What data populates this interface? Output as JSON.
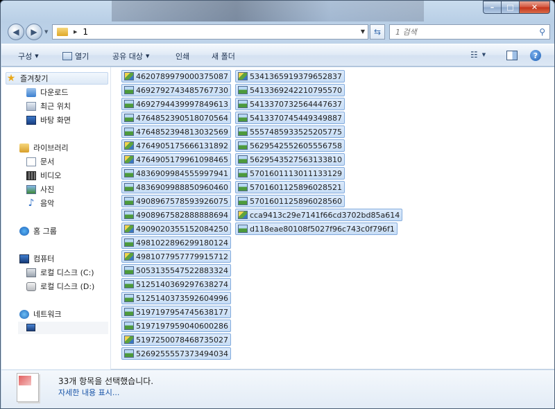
{
  "window": {
    "caption_buttons": {
      "minimize": "–",
      "maximize": "□",
      "close": "✕"
    }
  },
  "address_bar": {
    "path": "1",
    "search_placeholder": "1 검색"
  },
  "toolbar": {
    "organize": "구성",
    "open": "열기",
    "share_with": "공유 대상",
    "print": "인쇄",
    "new_folder": "새 폴더"
  },
  "nav": {
    "favorites": "즐겨찾기",
    "downloads": "다운로드",
    "recent_places": "최근 위치",
    "desktop": "바탕 화면",
    "libraries": "라이브러리",
    "documents": "문서",
    "videos": "비디오",
    "pictures": "사진",
    "music": "음악",
    "homegroup": "홈 그룹",
    "computer": "컴퓨터",
    "local_disk_c": "로컬 디스크 (C:)",
    "local_disk_d": "로컬 디스크 (D:)",
    "network": "네트워크"
  },
  "files": {
    "col1": [
      {
        "name": "4620789979000375087",
        "thumb": "b"
      },
      {
        "name": "4692792743485767730",
        "thumb": "a"
      },
      {
        "name": "4692794439997849613",
        "thumb": "a"
      },
      {
        "name": "4764852390518070564",
        "thumb": "a"
      },
      {
        "name": "4764852394813032569",
        "thumb": "a"
      },
      {
        "name": "4764905175666131892",
        "thumb": "b"
      },
      {
        "name": "4764905179961098465",
        "thumb": "b"
      },
      {
        "name": "4836909984555997941",
        "thumb": "a"
      },
      {
        "name": "4836909988850960460",
        "thumb": "a"
      },
      {
        "name": "4908967578593926075",
        "thumb": "a"
      },
      {
        "name": "4908967582888888694",
        "thumb": "a"
      },
      {
        "name": "4909020355152084250",
        "thumb": "b"
      },
      {
        "name": "4981022896299180124",
        "thumb": "a"
      },
      {
        "name": "4981077957779915712",
        "thumb": "b"
      },
      {
        "name": "5053135547522883324",
        "thumb": "a"
      },
      {
        "name": "5125140369297638274",
        "thumb": "a"
      },
      {
        "name": "5125140373592604996",
        "thumb": "a"
      },
      {
        "name": "5197197954745638177",
        "thumb": "a"
      },
      {
        "name": "5197197959040600286",
        "thumb": "a"
      },
      {
        "name": "5197250078468735027",
        "thumb": "b"
      },
      {
        "name": "5269255557373494034",
        "thumb": "a"
      }
    ],
    "col2": [
      {
        "name": "5341365919379652837",
        "thumb": "b"
      },
      {
        "name": "5413369242210795570",
        "thumb": "a"
      },
      {
        "name": "5413370732564447637",
        "thumb": "a"
      },
      {
        "name": "5413370745449349887",
        "thumb": "a"
      },
      {
        "name": "5557485933525205775",
        "thumb": "a"
      },
      {
        "name": "5629542552605556758",
        "thumb": "a"
      },
      {
        "name": "5629543527563133810",
        "thumb": "a"
      },
      {
        "name": "5701601113011133129",
        "thumb": "a"
      },
      {
        "name": "5701601125896028521",
        "thumb": "a"
      },
      {
        "name": "5701601125896028560",
        "thumb": "a"
      },
      {
        "name": "cca9413c29e7141f66cd3702bd85a614",
        "thumb": "b"
      },
      {
        "name": "d118eae80108f5027f96c743c0f796f1",
        "thumb": "a"
      }
    ]
  },
  "details": {
    "selection_count": "33개 항목을 선택했습니다.",
    "show_more": "자세한 내용 표시..."
  }
}
